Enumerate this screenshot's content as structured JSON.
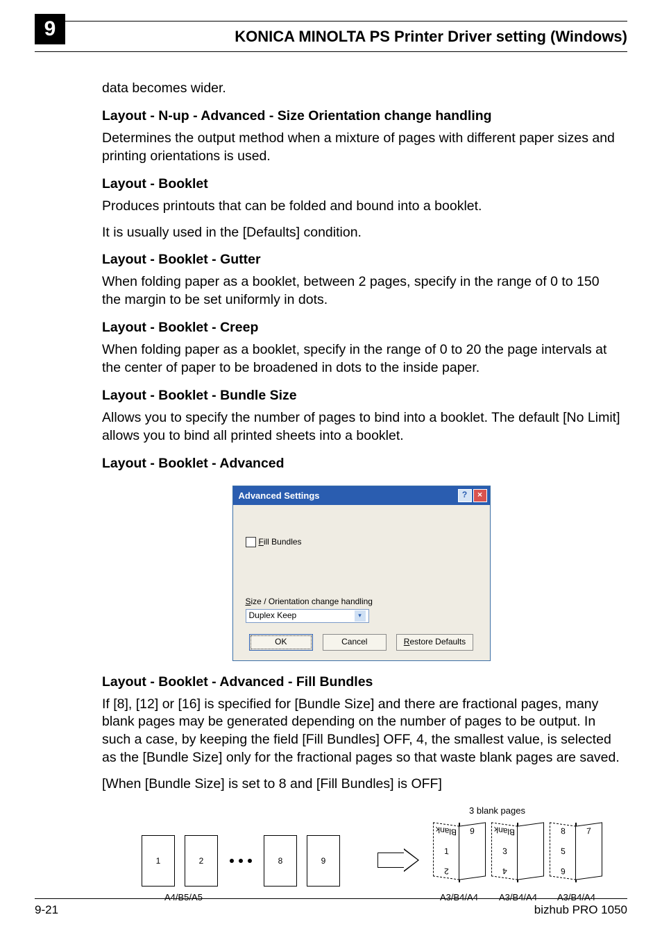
{
  "header": {
    "chapter_number": "9",
    "doc_title": "KONICA MINOLTA PS Printer Driver setting (Windows)"
  },
  "body": {
    "intro_leftover": "data becomes wider.",
    "h_nup_size": "Layout - N-up - Advanced - Size Orientation change handling",
    "p_nup_size": "Determines the output method when a mixture of pages with different paper sizes and printing orientations is used.",
    "h_booklet": "Layout - Booklet",
    "p_booklet_1": "Produces printouts that can be folded and bound into a booklet.",
    "p_booklet_2": "It is usually used in the [Defaults] condition.",
    "h_gutter": "Layout - Booklet - Gutter",
    "p_gutter": "When folding paper as a booklet, between 2 pages, specify in the range of 0 to 150 the margin to be set uniformly in dots.",
    "h_creep": "Layout - Booklet - Creep",
    "p_creep": "When folding paper as a booklet, specify in the range of 0 to 20 the page intervals at the center of paper to be broadened in dots to the inside paper.",
    "h_bundle_size": "Layout - Booklet - Bundle Size",
    "p_bundle_size": "Allows you to specify the number of pages to  bind into a booklet. The default [No Limit] allows you to bind all printed sheets into a booklet.",
    "h_advanced": "Layout - Booklet - Advanced",
    "h_fill_bundles": "Layout - Booklet - Advanced - Fill Bundles",
    "p_fill_bundles": "If [8], [12] or [16] is specified for [Bundle Size] and there are fractional pages, many blank pages may be generated depending on the number of pages to be output.  In such a case, by keeping the field [Fill Bundles] OFF, 4, the smallest value, is selected as the [Bundle Size] only for the fractional pages so that waste blank pages are saved.",
    "p_example_caption": "[When [Bundle Size] is set to 8 and [Fill Bundles] is OFF]"
  },
  "dialog": {
    "title": "Advanced Settings",
    "help_btn": "?",
    "close_btn": "×",
    "checkbox_label_prefix": "F",
    "checkbox_label_rest": "ill Bundles",
    "select_label_prefix": "S",
    "select_label_rest": "ize / Orientation change handling",
    "select_value": "Duplex Keep",
    "ok": "OK",
    "cancel": "Cancel",
    "restore_prefix": "R",
    "restore_rest": "estore Defaults"
  },
  "diagram": {
    "blank_pages_label": "3 blank pages",
    "flat_labels": [
      "1",
      "2",
      "8",
      "9"
    ],
    "a4_caption": "A4/B5/A5",
    "books": [
      {
        "tl": "Blank",
        "tr": "9",
        "bl": "Blank",
        "br": "1",
        "lb": "2",
        "tl_upside": true,
        "lb_upside": true
      },
      {
        "tl": "",
        "tr": "",
        "bl": "Blank",
        "br": "3",
        "lb": "4",
        "tl_upside": true,
        "lb_upside": true
      },
      {
        "tl": "",
        "tr": "7",
        "bl": "8",
        "br": "5",
        "lb": "6",
        "tl_upside": false,
        "lb_upside": true
      }
    ],
    "a3_caption": "A3/B4/A4"
  },
  "footer": {
    "page_num": "9-21",
    "product": "bizhub PRO 1050"
  }
}
